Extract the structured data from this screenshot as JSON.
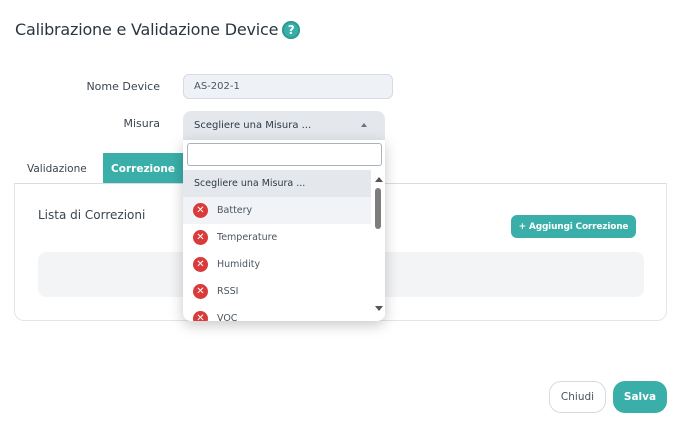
{
  "header": {
    "title": "Calibrazione e Validazione Device",
    "help_icon": "?"
  },
  "form": {
    "nome_device_label": "Nome Device",
    "nome_device_value": "AS-202-1",
    "misura_label": "Misura",
    "misura_selected": "Scegliere una Misura ..."
  },
  "tabs": [
    {
      "label": "Validazione",
      "active": false
    },
    {
      "label": "Correzione",
      "active": true
    }
  ],
  "panel": {
    "title": "Lista di Correzioni",
    "add_button": "+ Aggiungi Correzione"
  },
  "dropdown": {
    "search_value": "",
    "options": [
      {
        "label": "Scegliere una Misura ...",
        "icon": ""
      },
      {
        "label": "Battery",
        "icon": "error-icon"
      },
      {
        "label": "Temperature",
        "icon": "error-icon"
      },
      {
        "label": "Humidity",
        "icon": "error-icon"
      },
      {
        "label": "RSSI",
        "icon": "error-icon"
      },
      {
        "label": "VOC",
        "icon": "error-icon"
      }
    ]
  },
  "footer": {
    "close_label": "Chiudi",
    "save_label": "Salva"
  },
  "colors": {
    "accent": "#3aafa9",
    "error": "#d93a3a"
  }
}
